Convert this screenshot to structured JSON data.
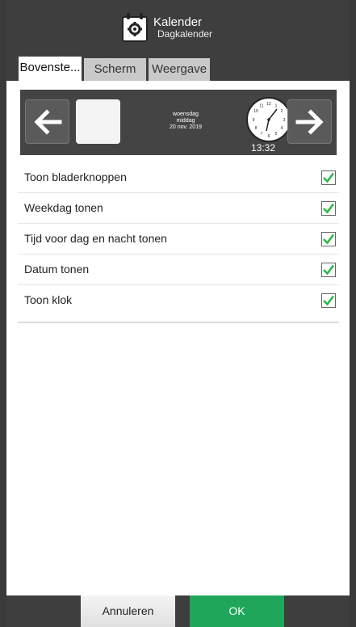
{
  "header": {
    "title": "Kalender",
    "subtitle": "Dagkalender"
  },
  "tabs": [
    {
      "label": "Bovenste...",
      "active": true
    },
    {
      "label": "Scherm",
      "active": false
    },
    {
      "label": "Weergave",
      "active": false
    }
  ],
  "preview": {
    "weekday": "woensdag",
    "daypart": "middag",
    "date": "20 nov. 2019",
    "time": "13:32",
    "clock_icon": "analog-clock-icon",
    "back_icon": "arrow-left-icon",
    "forward_icon": "arrow-right-icon"
  },
  "options": [
    {
      "label": "Toon bladerknoppen",
      "checked": true
    },
    {
      "label": "Weekdag tonen",
      "checked": true
    },
    {
      "label": "Tijd voor dag en nacht tonen",
      "checked": true
    },
    {
      "label": "Datum tonen",
      "checked": true
    },
    {
      "label": "Toon klok",
      "checked": true
    }
  ],
  "footer": {
    "cancel_label": "Annuleren",
    "ok_label": "OK"
  },
  "colors": {
    "accent_green": "#1fa65a",
    "check_green": "#2db84a",
    "chrome": "#3e3e3e"
  }
}
